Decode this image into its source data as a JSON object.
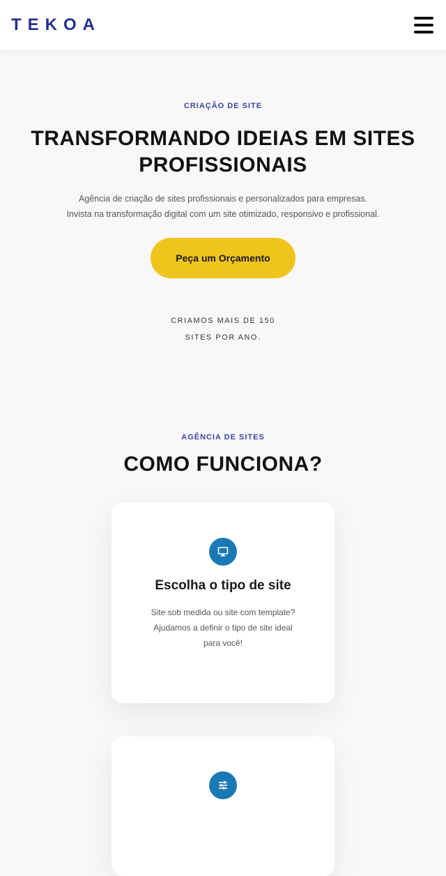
{
  "header": {
    "logo": "TEKOA",
    "menu_icon": "hamburger-menu-icon"
  },
  "hero": {
    "eyebrow": "CRIAÇÃO DE SITE",
    "title_line1": "TRANSFORMANDO IDEIAS EM SITES",
    "title_line2": "PROFISSIONAIS",
    "desc_line1": "Agência de criação de sites profissionais e personalizados para empresas.",
    "desc_line2": "Invista na transformação digital com um site otimizado, responsivo e profissional.",
    "cta_label": "Peça um Orçamento",
    "stat_line1": "CRIAMOS MAIS DE 150",
    "stat_line2": "SITES POR ANO."
  },
  "how_it_works": {
    "eyebrow": "AGÊNCIA DE SITES",
    "title": "COMO FUNCIONA?",
    "cards": [
      {
        "icon": "monitor-icon",
        "title": "Escolha o tipo de site",
        "desc_line1": "Site sob medida ou site com template?",
        "desc_line2": "Ajudamos a definir o tipo de site ideal",
        "desc_line3": "para você!"
      },
      {
        "icon": "settings-sliders-icon"
      }
    ]
  },
  "colors": {
    "brand": "#25308f",
    "eyebrow": "#3a44a0",
    "cta": "#efc41d",
    "icon_bg": "#1a79b5",
    "page_bg": "#f8f8f8"
  }
}
